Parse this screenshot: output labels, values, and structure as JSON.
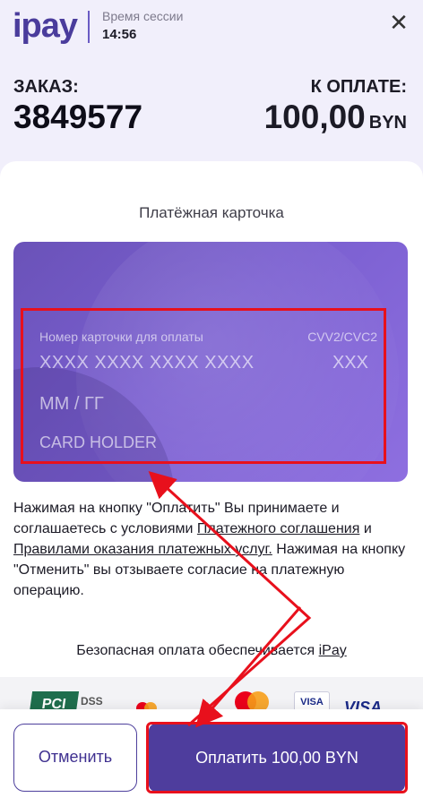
{
  "header": {
    "logo_text": "ipay",
    "session_label": "Время сессии",
    "session_time": "14:56",
    "close_icon": "close-icon"
  },
  "order": {
    "label": "ЗАКАЗ:",
    "number": "3849577"
  },
  "payment": {
    "label": "К ОПЛАТЕ:",
    "amount": "100,00",
    "currency": "BYN"
  },
  "card_form": {
    "title": "Платёжная карточка",
    "number_label": "Номер карточки для оплаты",
    "number_placeholder": "XXXX XXXX XXXX XXXX",
    "cvv_label": "CVV2/CVC2",
    "cvv_placeholder": "XXX",
    "expiry_placeholder": "ММ / ГГ",
    "holder_placeholder": "CARD HOLDER"
  },
  "terms": {
    "part1": "Нажимая на кнопку \"Оплатить\" Вы принимаете и соглашаетесь с условиями ",
    "link1": "Платежного соглашения",
    "part2": " и ",
    "link2": "Правилами оказания платежных услуг.",
    "part3": " Нажимая на кнопку \"Отменить\" вы отзываете согласие на платежную операцию."
  },
  "secure": {
    "text": "Безопасная оплата обеспечивается ",
    "link": "iPay"
  },
  "logos": {
    "pci": "PCI",
    "dss": "DSS",
    "visa1": "VISA",
    "visa2": "VISA"
  },
  "actions": {
    "cancel_label": "Отменить",
    "pay_label": "Оплатить 100,00 BYN"
  },
  "colors": {
    "brand": "#4e3d9d",
    "header_bg": "#f1effb",
    "card_gradient_start": "#6a52b8",
    "card_gradient_end": "#8e6fe0",
    "annotation_red": "#e8101c"
  }
}
